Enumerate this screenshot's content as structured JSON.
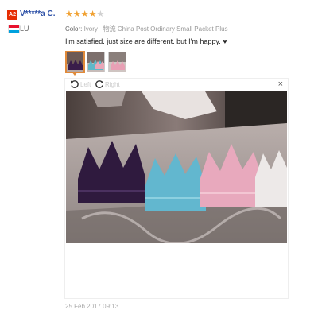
{
  "reviewer": {
    "badge": "A2",
    "name": "V*****a C.",
    "country": "LU"
  },
  "rating": {
    "value": 4,
    "max": 5
  },
  "meta": {
    "color_label": "Color:",
    "color_value": "Ivory",
    "ship_cn": "物流",
    "shipping": "China Post Ordinary Small Packet Plus"
  },
  "review": {
    "text": "I'm satisfied. just size are different. but I'm happy. ♥"
  },
  "viewer": {
    "rotate_left": "Left",
    "rotate_right": "Right",
    "close": "×"
  },
  "icons": {
    "rotate_left": "rotate-left-icon",
    "rotate_right": "rotate-right-icon",
    "close": "close-icon"
  },
  "date": "25 Feb 2017 09:13",
  "colors": {
    "badge": "#e62e04",
    "name": "#2b4fa6",
    "star": "#f0a030",
    "thumb_selected": "#e08a3a"
  }
}
